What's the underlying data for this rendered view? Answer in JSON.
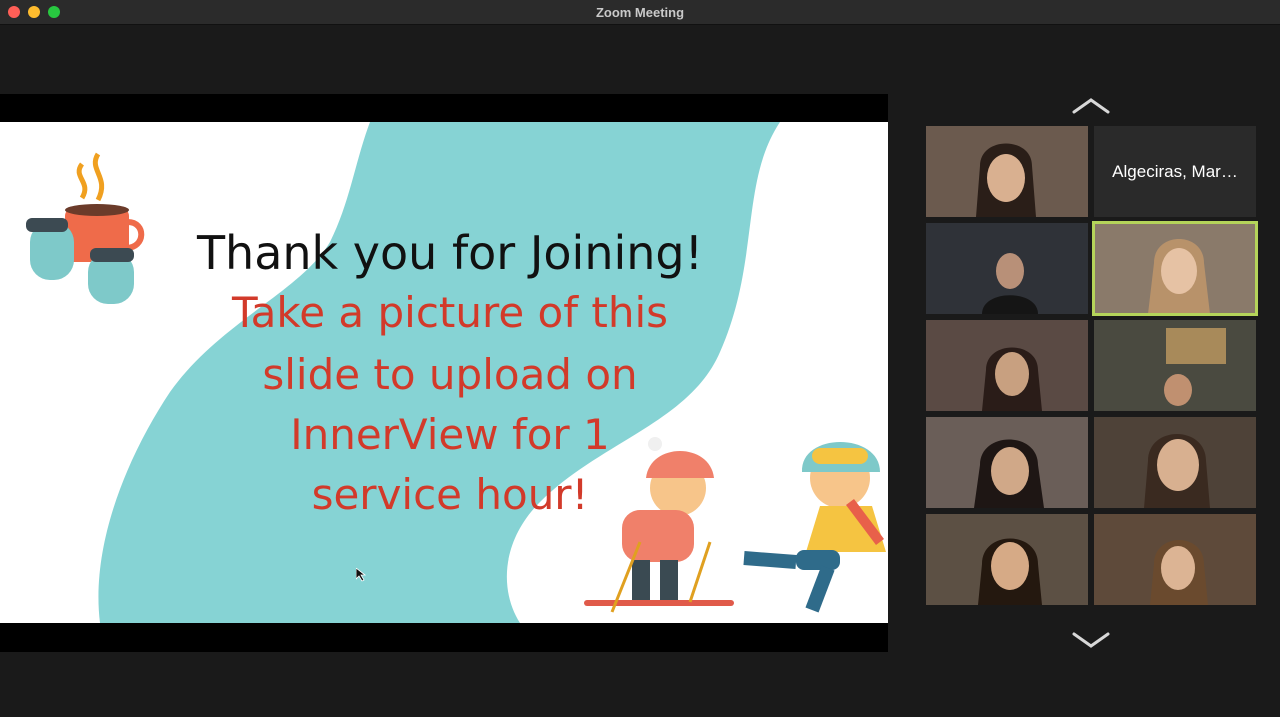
{
  "window": {
    "title": "Zoom Meeting"
  },
  "slide": {
    "line1": "Thank you for Joining!",
    "line2": "Take a picture of this",
    "line3": "slide to upload on",
    "line4": "InnerView for 1",
    "line5": "service hour!"
  },
  "gallery": {
    "participants": [
      {
        "name": "",
        "tone": "#6b5a4e"
      },
      {
        "name": "Algeciras, Mar…",
        "tone": "#2a2a2a"
      },
      {
        "name": "",
        "tone": "#2f3238"
      },
      {
        "name": "",
        "tone": "#8a7a6a"
      },
      {
        "name": "",
        "tone": "#5a4a44"
      },
      {
        "name": "",
        "tone": "#4a4a40"
      },
      {
        "name": "",
        "tone": "#6a5e58"
      },
      {
        "name": "",
        "tone": "#4e4238"
      },
      {
        "name": "",
        "tone": "#5c5044"
      },
      {
        "name": "",
        "tone": "#5e4a3a"
      }
    ]
  },
  "colors": {
    "active_speaker": "#b5d45a",
    "slide_blob": "#86d3d4",
    "slide_red": "#d23a2a"
  }
}
